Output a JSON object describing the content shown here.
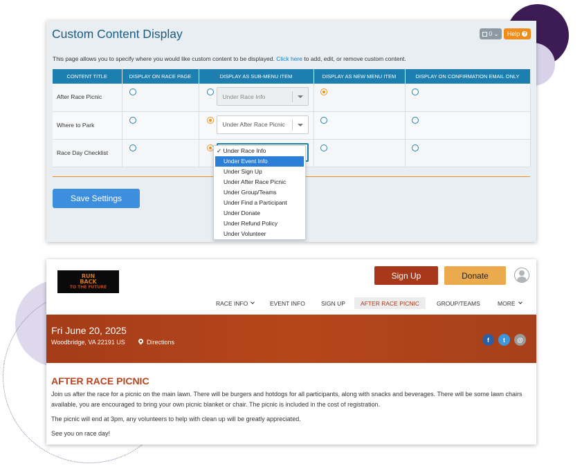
{
  "admin": {
    "title": "Custom Content Display",
    "count_label": "0",
    "help_label": "Help",
    "intro_text": "This page allows you to specify where you would like custom content to be displayed.",
    "intro_link": "Click here",
    "intro_rest": "to add, edit, or remove custom content.",
    "columns": [
      "CONTENT TITLE",
      "DISPLAY ON RACE PAGE",
      "DISPLAY AS SUB-MENU ITEM",
      "DISPLAY AS NEW MENU ITEM",
      "DISPLAY ON CONFIRMATION EMAIL ONLY"
    ],
    "rows": [
      {
        "title": "After Race Picnic",
        "submenu_value": "Under Race Info",
        "selected": "new_menu"
      },
      {
        "title": "Where to Park",
        "submenu_value": "Under After Race Picnic",
        "selected": "submenu"
      },
      {
        "title": "Race Day Checklist",
        "submenu_value": "",
        "selected": "submenu"
      }
    ],
    "dropdown_options": [
      "Under Race Info",
      "Under Event Info",
      "Under Sign Up",
      "Under After Race Picnic",
      "Under Group/Teams",
      "Under Find a Participant",
      "Under Donate",
      "Under Refund Policy",
      "Under Volunteer"
    ],
    "dropdown_checked": "✓ Under Race Info",
    "dropdown_highlighted": "Under Event Info",
    "save_label": "Save Settings"
  },
  "site": {
    "logo_line1": "RUN",
    "logo_line2": "BACK",
    "logo_line3": "TO THE FUTURE",
    "signup_label": "Sign Up",
    "donate_label": "Donate",
    "nav": [
      "RACE INFO",
      "EVENT INFO",
      "SIGN UP",
      "AFTER RACE PICNIC",
      "GROUP/TEAMS",
      "MORE"
    ],
    "active_nav": "AFTER RACE PICNIC",
    "event_date": "Fri June 20, 2025",
    "event_location": "Woodbridge, VA 22191 US",
    "directions_label": "Directions",
    "social": {
      "facebook": "f",
      "twitter": "t",
      "email": "@"
    },
    "page_heading": "AFTER RACE PICNIC",
    "paragraphs": [
      "Join us after the race for a picnic on the main lawn. There will be burgers and hotdogs for all participants, along with snacks and beverages. There will be some lawn chairs available, you are encouraged to bring your own picnic blanket or chair. The picnic is included in the cost of registration.",
      "The picnic will end at 3pm, any volunteers to help with clean up will be greatly appreciated.",
      "See you on race day!"
    ]
  },
  "colors": {
    "admin_header": "#1d7fb0",
    "accent_orange": "#f08c17",
    "brand_red": "#a8381a",
    "donate_gold": "#ebaa4e"
  }
}
